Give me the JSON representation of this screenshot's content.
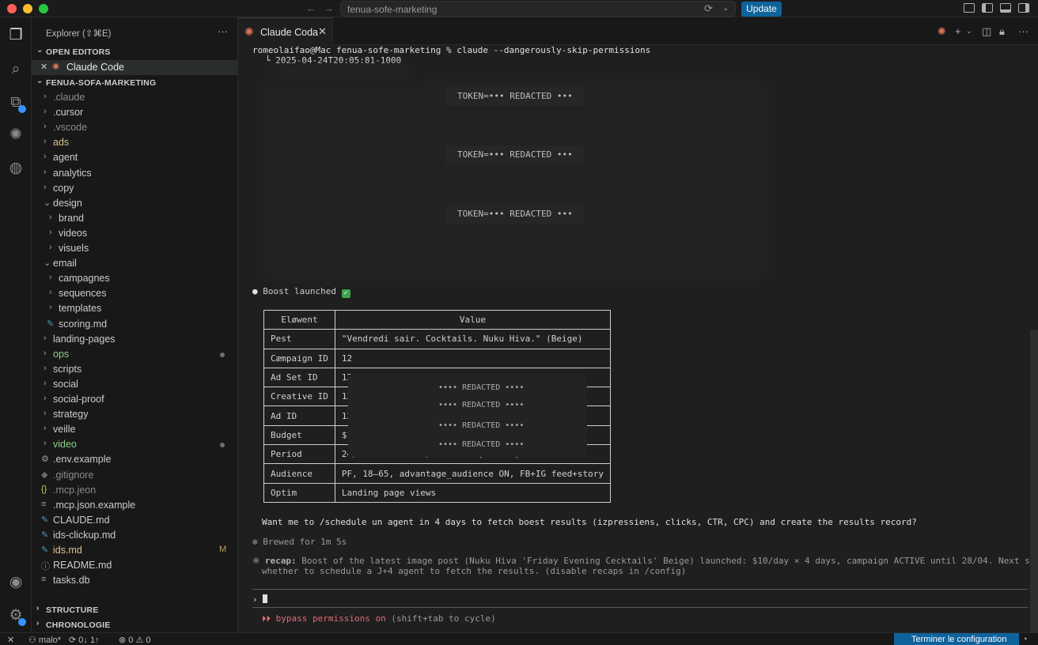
{
  "titlebar": {
    "search_text": "fenua-sofe-marketing",
    "update_label": "Update",
    "colors": {
      "update": "#0e639c"
    }
  },
  "activity_icons": [
    "explorer-icon",
    "search-icon",
    "extensions-icon",
    "claude-icon",
    "remote-icon",
    "account-icon",
    "settings-icon"
  ],
  "sidebar": {
    "title": "Explorer (⇧⌘E)",
    "more": "···",
    "open_editors_label": "OPEN EDITORS",
    "open_editors": [
      {
        "close": "✕",
        "label": "Claude Code"
      }
    ],
    "project_label": "FENUA-SOFA-MARKETING",
    "tree": [
      {
        "label": ".claude"
      },
      {
        "label": ".cursor"
      },
      {
        "label": ".vscode"
      },
      {
        "label": "ads"
      },
      {
        "label": "agent"
      },
      {
        "label": "analytics"
      },
      {
        "label": "copy"
      },
      {
        "label": "design"
      },
      {
        "label": "brand"
      },
      {
        "label": "videos"
      },
      {
        "label": "visuels"
      },
      {
        "label": "email"
      },
      {
        "label": "campagnes"
      },
      {
        "label": "sequences"
      },
      {
        "label": "templates"
      },
      {
        "label": "scoring.md"
      },
      {
        "label": "landing-pages"
      },
      {
        "label": "ops"
      },
      {
        "label": "scripts"
      },
      {
        "label": "social"
      },
      {
        "label": "social-proof"
      },
      {
        "label": "strategy"
      },
      {
        "label": "veille"
      },
      {
        "label": "video"
      },
      {
        "label": ".env.example"
      },
      {
        "label": ".gitignore"
      },
      {
        "label": ".mcp.jeon"
      },
      {
        "label": ".mcp.json.example"
      },
      {
        "label": "CLAUDE.md"
      },
      {
        "label": "ids-clickup.md"
      },
      {
        "label": "ids.md",
        "badge": "M"
      },
      {
        "label": "README.md"
      },
      {
        "label": "tasks.db"
      }
    ],
    "structure_label": "STRUCTURE",
    "chronologie_label": "CHRONOLOGIE"
  },
  "editor": {
    "tab_label": "Claude Coda",
    "tab_close": "✕"
  },
  "terminal": {
    "command": "romeolaifao@Mac fenua-sofe-marketing % claude --dangerously-skip-permissions",
    "timestamp": "└ 2025-04-24T20:05:81-1000",
    "token_text": "TOKEN=••• REDACTED •••",
    "boost_text": "Boost launched",
    "check": "✓",
    "table_header": [
      "Eløwent",
      "Value"
    ],
    "table_rows": [
      [
        "Pest",
        "\"Vendredi sair. Cocktails. Nuku Hiva.\" (Beige)"
      ],
      [
        "Cæmpaign ID",
        "12"
      ],
      [
        "Ad Set ID",
        "12"
      ],
      [
        "Creative ID",
        "13"
      ],
      [
        "Ad ID",
        "12"
      ],
      [
        "Budget",
        "$10/jour × 4 jours = $40 total"
      ],
      [
        "Period",
        "24/04 20h10 → 28/04 20h10 (Tahiti)"
      ],
      [
        "Audience",
        "PF, 18–65, advantage_audience ON, FB+IG feed+story"
      ],
      [
        "Optim",
        "Landing page views"
      ]
    ],
    "redacted_label": "•••• REDACTED ••••",
    "question": "Want me to /schedule un agent in 4 days to fetch boest results (izpressiens, clicks, CTR, CPC) and create the results record?",
    "brewed": "Brewed for 1m 5s",
    "recap_label": "recap:",
    "recap_line1": "Boost of the latest image post (Nuku Hiva 'Friday Evening Cecktails' Beige) launched: $10/day × 4 days, campaign ACTIVE until 28/04. Next step: decide",
    "recap_line2": "whether to schedule a J+4 agent to fetch the results. (disable recaps in /config)",
    "prompt": "›",
    "bypass_arrows": "⏵⏵",
    "bypass_label": "bypass permissions on",
    "bypass_hint": "(shift+tab to cycle)"
  },
  "statusbar": {
    "user": "malo*",
    "sync": "0↓ 1↑",
    "errors": "0",
    "warnings": "0",
    "config_label": "Terminer le configuration"
  }
}
